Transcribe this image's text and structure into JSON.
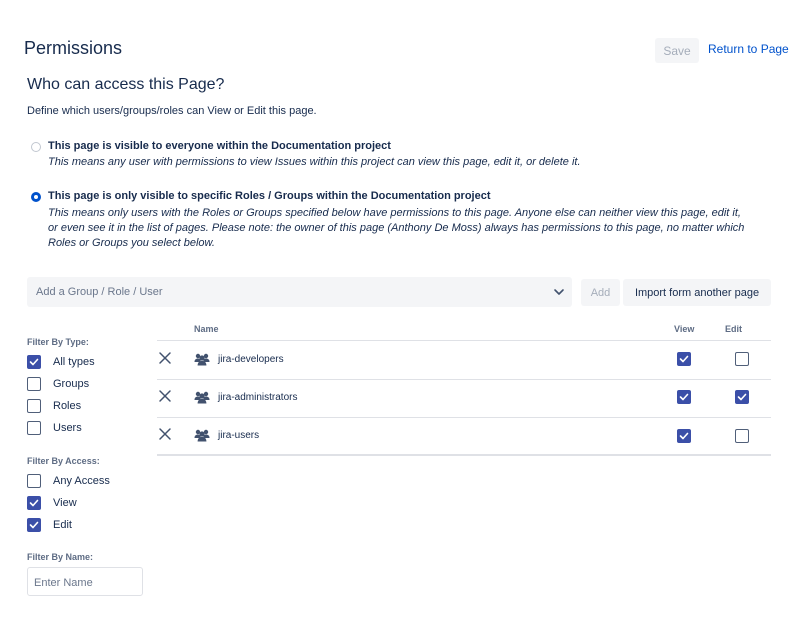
{
  "header": {
    "title": "Permissions",
    "save_label": "Save",
    "return_label": "Return to Page"
  },
  "access": {
    "title": "Who can access this Page?",
    "description": "Define which users/groups/roles can View or Edit this page.",
    "options": [
      {
        "title": "This page is visible to everyone within the Documentation project",
        "desc_lines": [
          "This means any user with permissions to view Issues within this project can view this page, edit it, or delete it."
        ],
        "selected": false
      },
      {
        "title": "This page is only visible to specific Roles / Groups within the Documentation project",
        "desc_lines": [
          "This means only users with the Roles or Groups specified below have permissions to this page. Anyone else can neither view this page, edit it,",
          "or even see it in the list of pages. Please note: the owner of this page (Anthony De Moss) always has permissions to this page, no matter which",
          "Roles or Groups you select below."
        ],
        "selected": true
      }
    ]
  },
  "add_bar": {
    "placeholder": "Add a Group / Role / User",
    "add_label": "Add",
    "import_label": "Import form another page"
  },
  "filters": {
    "type_heading": "Filter By Type:",
    "type_items": [
      {
        "label": "All types",
        "checked": true
      },
      {
        "label": "Groups",
        "checked": false
      },
      {
        "label": "Roles",
        "checked": false
      },
      {
        "label": "Users",
        "checked": false
      }
    ],
    "access_heading": "Filter By Access:",
    "access_items": [
      {
        "label": "Any Access",
        "checked": false
      },
      {
        "label": "View",
        "checked": true
      },
      {
        "label": "Edit",
        "checked": true
      }
    ],
    "name_heading": "Filter By Name:",
    "name_placeholder": "Enter Name"
  },
  "table": {
    "col_name": "Name",
    "col_view": "View",
    "col_edit": "Edit",
    "rows": [
      {
        "name": "jira-developers",
        "view": true,
        "edit": false
      },
      {
        "name": "jira-administrators",
        "view": true,
        "edit": true
      },
      {
        "name": "jira-users",
        "view": true,
        "edit": false
      }
    ]
  },
  "colors": {
    "accent": "#0052cc",
    "checkbox_on": "#3b4fa8",
    "text": "#172b4d",
    "muted": "#5e6c84"
  },
  "icons": {
    "remove": "close-icon",
    "group": "group-icon",
    "dropdown": "chevron-down-icon",
    "check": "checkmark-icon"
  }
}
